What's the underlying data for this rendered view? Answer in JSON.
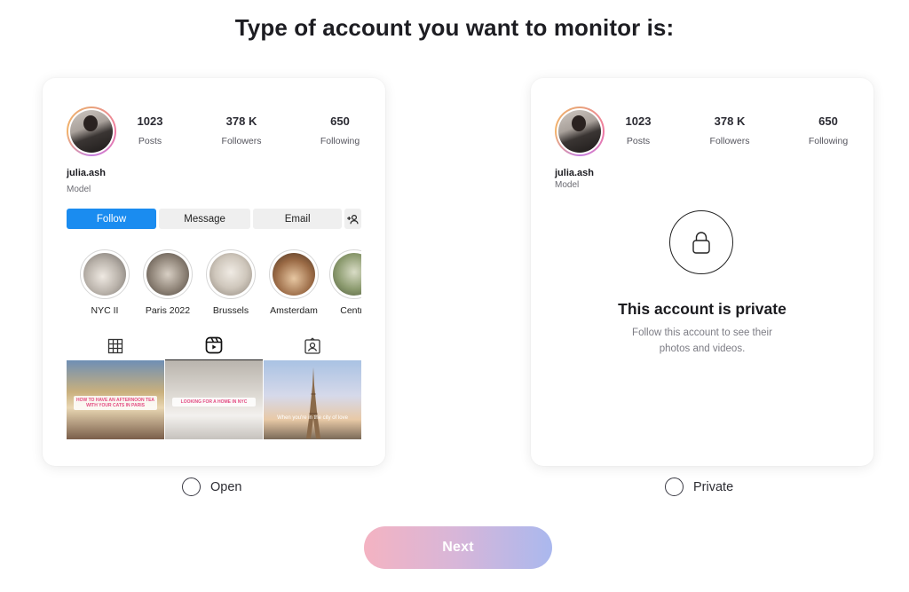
{
  "title": "Type of account you want to monitor is:",
  "profile": {
    "username": "julia.ash",
    "bio": "Model",
    "stats": [
      {
        "value": "1023",
        "label": "Posts"
      },
      {
        "value": "378 K",
        "label": "Followers"
      },
      {
        "value": "650",
        "label": "Following"
      }
    ]
  },
  "open_card": {
    "buttons": {
      "follow": "Follow",
      "message": "Message",
      "email": "Email",
      "add_user_icon": "+&"
    },
    "highlights": [
      {
        "label": "NYC II",
        "color": "#b9b2aa"
      },
      {
        "label": "Paris 2022",
        "color": "#8f8478"
      },
      {
        "label": "Brussels",
        "color": "#cfc7bc"
      },
      {
        "label": "Amsterdam",
        "color": "#9a6a45"
      },
      {
        "label": "Centra",
        "color": "#8b9a6e"
      }
    ],
    "tabs": [
      "grid-icon",
      "reels-icon",
      "tagged-icon"
    ],
    "posts": [
      {
        "overlay": "HOW TO HAVE AN AFTERNOON TEA WITH YOUR CATS IN PARIS"
      },
      {
        "overlay": "LOOKING FOR A HOME IN NYC"
      },
      {
        "overlay": "When you're in the city of love"
      }
    ]
  },
  "private_card": {
    "title": "This account is private",
    "subtitle_line1": "Follow this account to see their",
    "subtitle_line2": "photos and videos."
  },
  "options": {
    "open": "Open",
    "private": "Private"
  },
  "next_label": "Next",
  "colors": {
    "follow_blue": "#1a8cf0",
    "next_gradient_start": "#f4b3c2",
    "next_gradient_end": "#aab8ee"
  }
}
